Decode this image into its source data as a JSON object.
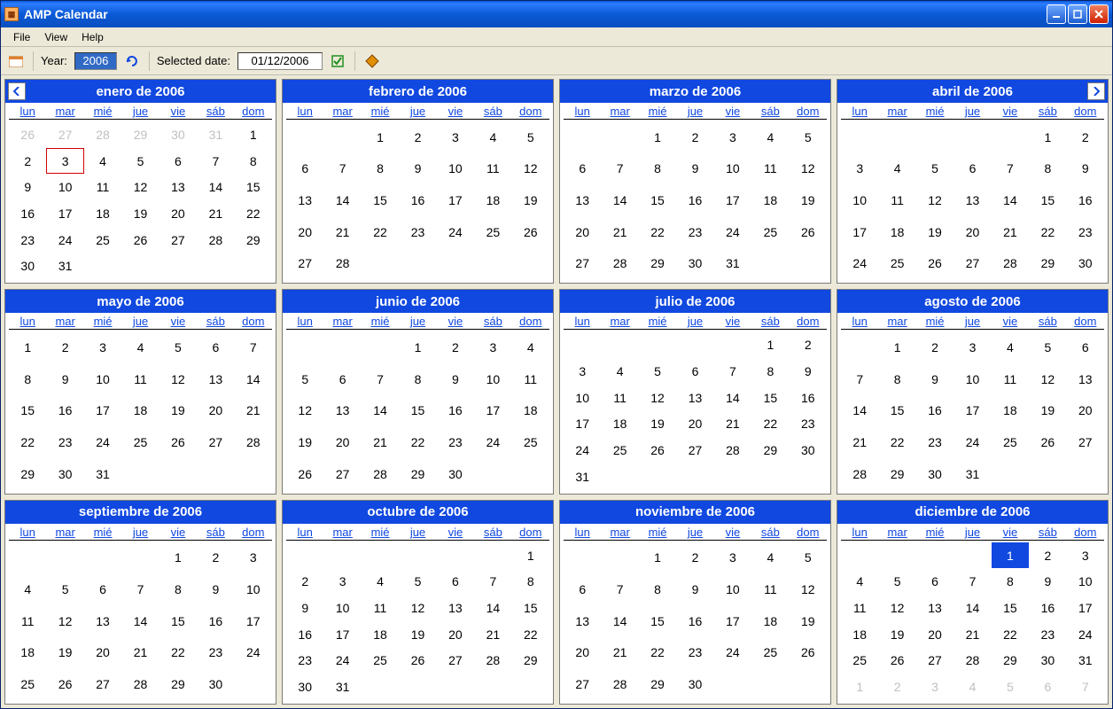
{
  "window": {
    "title": "AMP Calendar"
  },
  "menu": {
    "file": "File",
    "view": "View",
    "help": "Help"
  },
  "toolbar": {
    "year_label": "Year:",
    "year_value": "2006",
    "selected_label": "Selected date:",
    "selected_value": "01/12/2006"
  },
  "day_headers": [
    "lun",
    "mar",
    "mié",
    "jue",
    "vie",
    "sáb",
    "dom"
  ],
  "today": {
    "month": 0,
    "day": 3
  },
  "selected": {
    "month": 11,
    "day": 1
  },
  "months": [
    {
      "title": "enero de 2006",
      "leading_other": [
        26,
        27,
        28,
        29,
        30,
        31
      ],
      "days": 31,
      "trailing_other": []
    },
    {
      "title": "febrero de 2006",
      "leading_blank": 2,
      "days": 28,
      "trailing_other": []
    },
    {
      "title": "marzo de 2006",
      "leading_blank": 2,
      "days": 31,
      "trailing_other": []
    },
    {
      "title": "abril de 2006",
      "leading_blank": 5,
      "days": 30,
      "trailing_other": []
    },
    {
      "title": "mayo de 2006",
      "leading_blank": 0,
      "days": 31,
      "trailing_other": []
    },
    {
      "title": "junio de 2006",
      "leading_blank": 3,
      "days": 30,
      "trailing_other": []
    },
    {
      "title": "julio de 2006",
      "leading_blank": 5,
      "days": 31,
      "trailing_other": []
    },
    {
      "title": "agosto de 2006",
      "leading_blank": 1,
      "days": 31,
      "trailing_other": []
    },
    {
      "title": "septiembre de 2006",
      "leading_blank": 4,
      "days": 30,
      "trailing_other": []
    },
    {
      "title": "octubre de 2006",
      "leading_blank": 6,
      "days": 31,
      "trailing_other": []
    },
    {
      "title": "noviembre de 2006",
      "leading_blank": 2,
      "days": 30,
      "trailing_other": []
    },
    {
      "title": "diciembre de 2006",
      "leading_blank": 4,
      "days": 31,
      "trailing_other": [
        1,
        2,
        3,
        4,
        5,
        6,
        7
      ]
    }
  ]
}
